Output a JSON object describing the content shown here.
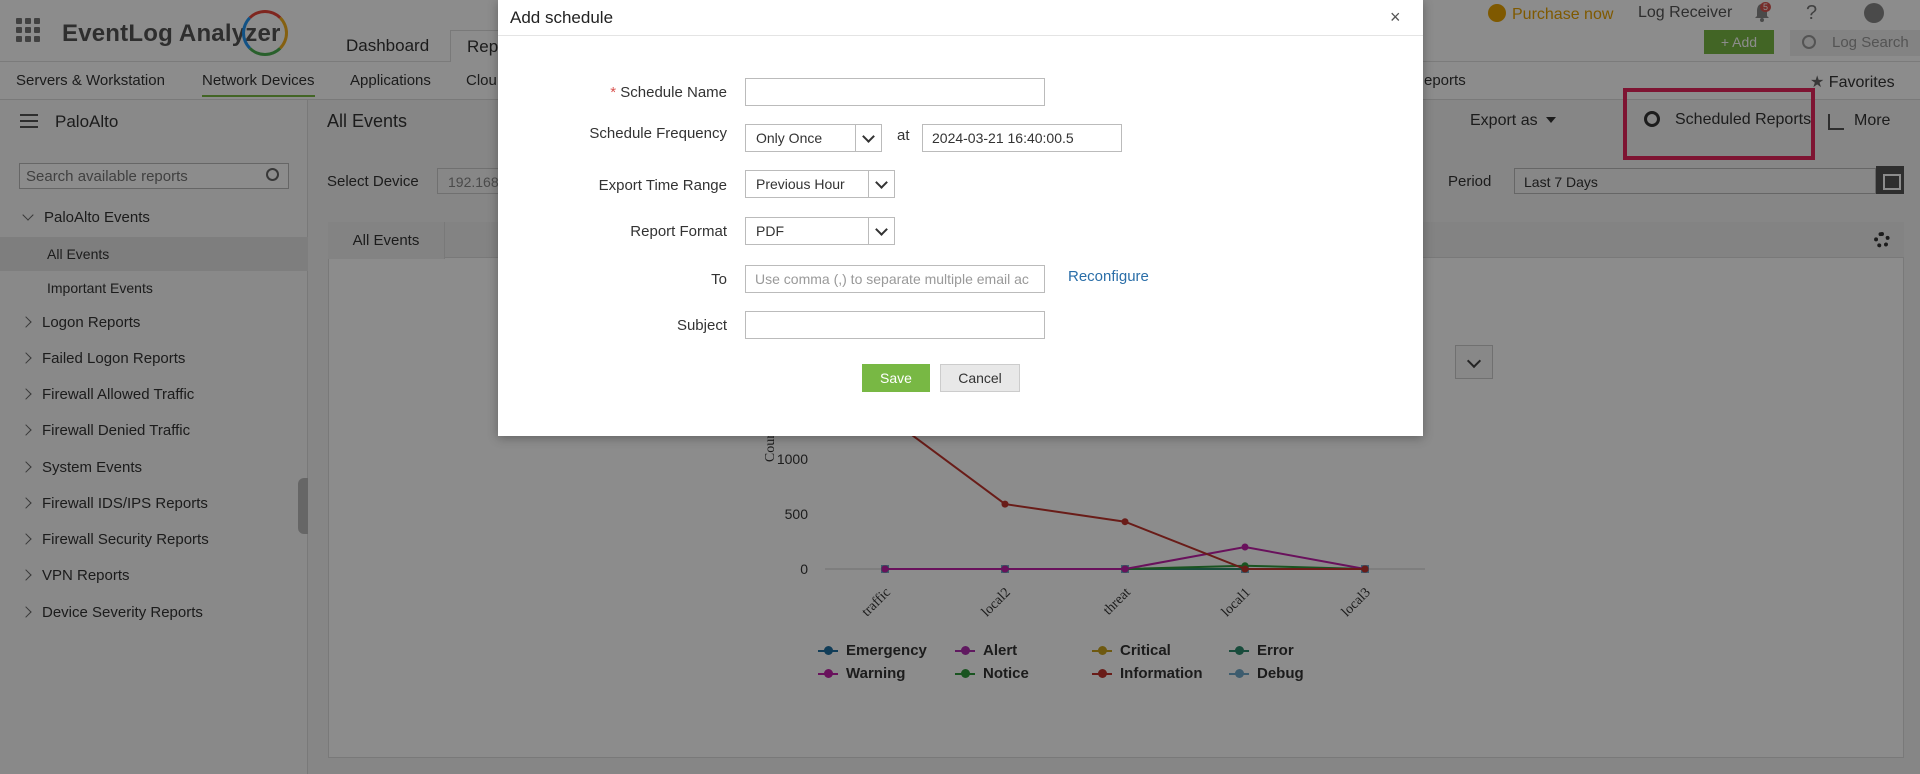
{
  "header": {
    "app_name": "EventLog Analyzer",
    "tabs": [
      "Dashboard",
      "Rep"
    ],
    "purchase": "Purchase now",
    "log_receiver": "Log Receiver",
    "bell_badge": "5",
    "help": "?",
    "add": "+  Add",
    "log_search": "Log Search"
  },
  "subnav": {
    "items": [
      "Servers & Workstation",
      "Network Devices",
      "Applications",
      "Clou",
      "eports"
    ],
    "favorites": "Favorites"
  },
  "sidebar": {
    "title": "PaloAlto",
    "search_placeholder": "Search available reports",
    "items": [
      {
        "label": "PaloAlto Events",
        "type": "group-open"
      },
      {
        "label": "All Events",
        "type": "child-selected"
      },
      {
        "label": "Important Events",
        "type": "child"
      },
      {
        "label": "Logon Reports",
        "type": "group"
      },
      {
        "label": "Failed Logon Reports",
        "type": "group"
      },
      {
        "label": "Firewall Allowed Traffic",
        "type": "group"
      },
      {
        "label": "Firewall Denied Traffic",
        "type": "group"
      },
      {
        "label": "System Events",
        "type": "group"
      },
      {
        "label": "Firewall IDS/IPS Reports",
        "type": "group"
      },
      {
        "label": "Firewall Security Reports",
        "type": "group"
      },
      {
        "label": "VPN Reports",
        "type": "group"
      },
      {
        "label": "Device Severity Reports",
        "type": "group"
      }
    ]
  },
  "content": {
    "title": "All Events",
    "export_as": "Export as",
    "scheduled_reports": "Scheduled Reports",
    "more": "More",
    "select_device_label": "Select Device",
    "select_device_value": "192.168",
    "period_label": "Period",
    "period_value": "Last 7 Days",
    "panel_tab": "All Events"
  },
  "modal": {
    "title": "Add schedule",
    "close": "×",
    "schedule_name_label": "Schedule Name",
    "required_mark": "*",
    "schedule_name_value": "",
    "frequency_label": "Schedule Frequency",
    "frequency_value": "Only Once",
    "at_label": "at",
    "datetime_value": "2024-03-21 16:40:00.5",
    "time_range_label": "Export Time Range",
    "time_range_value": "Previous Hour",
    "format_label": "Report Format",
    "format_value": "PDF",
    "to_label": "To",
    "to_placeholder": "Use comma (,) to separate multiple email ac",
    "reconfigure": "Reconfigure",
    "subject_label": "Subject",
    "subject_value": "",
    "save": "Save",
    "cancel": "Cancel"
  },
  "colors": {
    "accent_green": "#78b844",
    "highlight": "#e5265b",
    "link": "#2a6ea8"
  },
  "chart_data": {
    "type": "line",
    "categories": [
      "traffic",
      "local2",
      "threat",
      "local1",
      "local3"
    ],
    "ylabel": "Count",
    "y_ticks": [
      0,
      500,
      1000
    ],
    "series": [
      {
        "name": "Emergency",
        "color": "#1f6fa0",
        "values": [
          0,
          0,
          0,
          0,
          0
        ]
      },
      {
        "name": "Alert",
        "color": "#b02eb0",
        "values": [
          0,
          0,
          0,
          0,
          0
        ]
      },
      {
        "name": "Critical",
        "color": "#c8a21e",
        "values": [
          0,
          0,
          0,
          0,
          0
        ]
      },
      {
        "name": "Error",
        "color": "#2e8b6e",
        "values": [
          0,
          0,
          0,
          0,
          0
        ]
      },
      {
        "name": "Warning",
        "color": "#c01fa8",
        "values": [
          0,
          0,
          0,
          200,
          0
        ]
      },
      {
        "name": "Notice",
        "color": "#2f9a3b",
        "values": [
          0,
          0,
          0,
          30,
          0
        ]
      },
      {
        "name": "Information",
        "color": "#c0342c",
        "values": [
          1400,
          590,
          430,
          0,
          0
        ]
      },
      {
        "name": "Debug",
        "color": "#6fa8c8",
        "values": [
          0,
          0,
          0,
          0,
          0
        ]
      }
    ],
    "legend": [
      "Emergency",
      "Alert",
      "Critical",
      "Error",
      "Warning",
      "Notice",
      "Information",
      "Debug"
    ]
  }
}
